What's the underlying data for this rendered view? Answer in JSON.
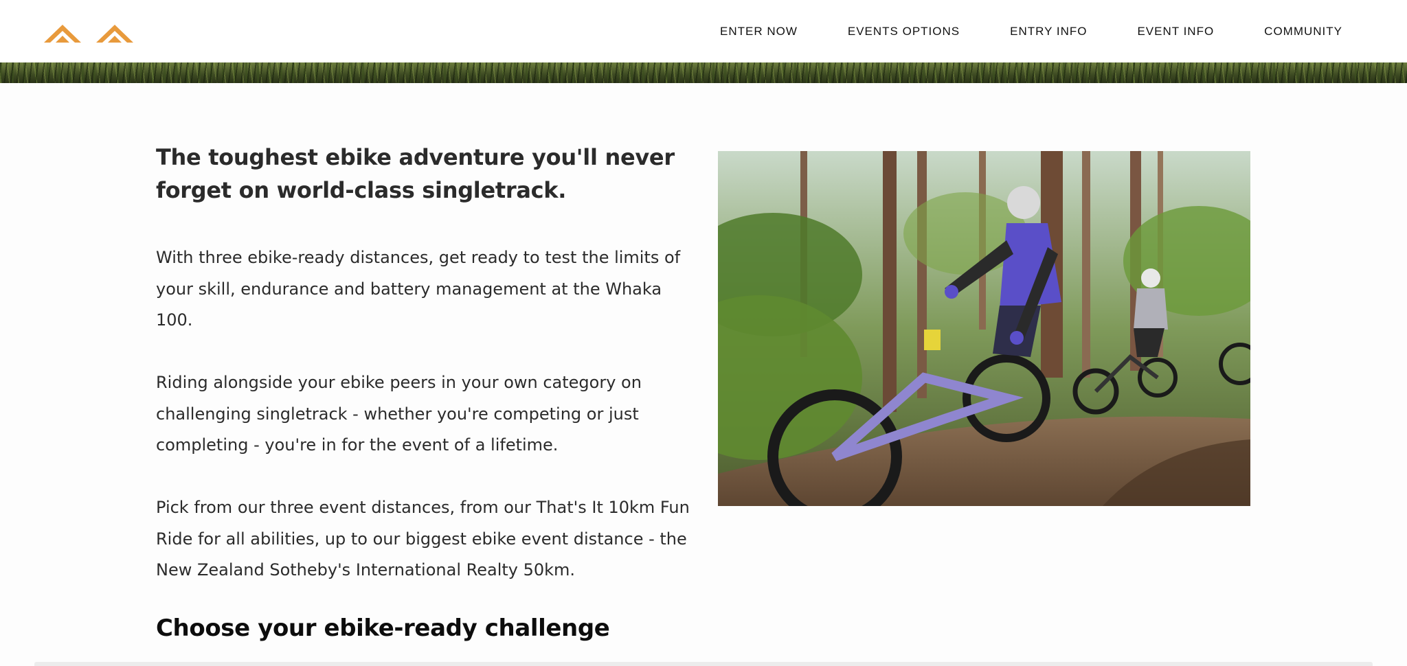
{
  "header": {
    "logo_name": "brand-logo",
    "nav": [
      {
        "label": "ENTER NOW"
      },
      {
        "label": "EVENTS OPTIONS"
      },
      {
        "label": "ENTRY INFO"
      },
      {
        "label": "EVENT INFO"
      },
      {
        "label": "COMMUNITY"
      }
    ]
  },
  "main": {
    "headline": "The toughest ebike adventure you'll never forget on world-class singletrack.",
    "paragraphs": [
      "With three ebike-ready distances, get ready to test the limits of your skill, endurance and battery management at the Whaka 100.",
      "Riding alongside your ebike peers in your own category on challenging singletrack - whether you're competing or just completing - you're in for the event of a lifetime.",
      "Pick from our three event distances, from our That's It 10km Fun Ride for all abilities, up to our biggest ebike event distance - the New Zealand Sotheby's International Realty 50km."
    ],
    "subheading": "Choose your ebike-ready challenge"
  },
  "colors": {
    "logo_orange": "#e89a3c",
    "text": "#2b2b2b",
    "bike_purple": "#5a4fc8"
  }
}
